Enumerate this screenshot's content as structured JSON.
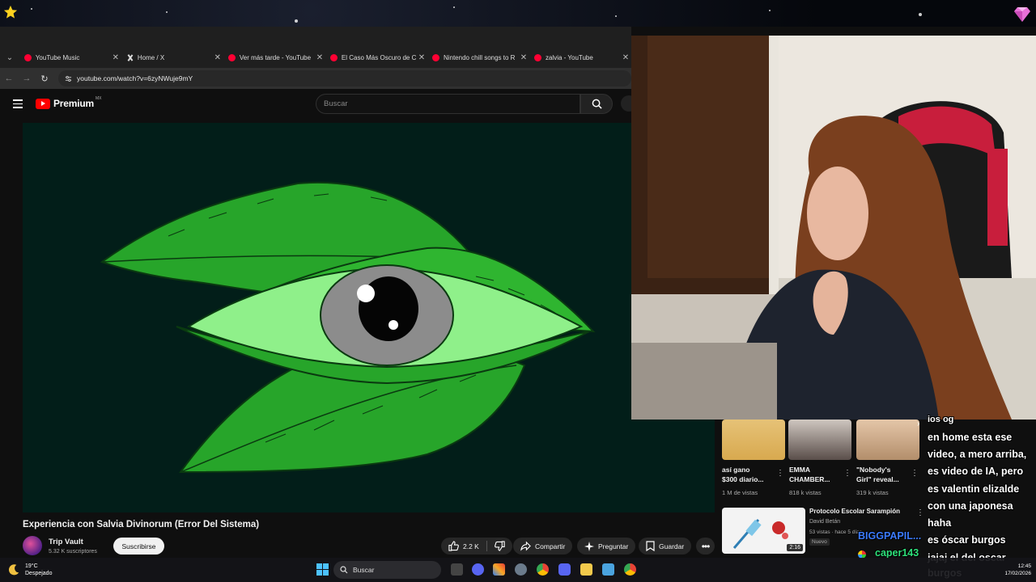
{
  "browser": {
    "tabs": [
      {
        "label": "YouTube Music",
        "icon": "youtube-music-icon"
      },
      {
        "label": "Home / X",
        "icon": "x-logo-icon"
      },
      {
        "label": "Ver más tarde - YouTube",
        "icon": "youtube-icon"
      },
      {
        "label": "El Caso Más Oscuro de C",
        "icon": "youtube-icon"
      },
      {
        "label": "Nintendo chill songs to R",
        "icon": "youtube-icon"
      },
      {
        "label": "zalvia - YouTube",
        "icon": "youtube-icon"
      }
    ],
    "url": "youtube.com/watch?v=6zyNWuje9mY"
  },
  "youtube": {
    "logo_text": "Premium",
    "country": "MX",
    "search_placeholder": "Buscar"
  },
  "video": {
    "title": "Experiencia con Salvia Divinorum (Error Del Sistema)",
    "channel": "Trip Vault",
    "subscribers": "5.32 K suscriptores",
    "subscribe_label": "Suscribirse",
    "likes": "2.2 K",
    "share_label": "Compartir",
    "ask_label": "Preguntar",
    "save_label": "Guardar"
  },
  "shorts": [
    {
      "title_l1": "así gano",
      "title_l2": "$300 diario...",
      "views": "1 M de vistas"
    },
    {
      "title_l1": "EMMA",
      "title_l2": "CHAMBER...",
      "views": "818 k vistas"
    },
    {
      "title_l1": "\"Nobody's",
      "title_l2": "Girl\" reveal...",
      "views": "319 k vistas"
    }
  ],
  "recommended": {
    "title": "Protocolo Escolar Sarampión",
    "channel": "David Betán",
    "meta": "53 vistas · hace 5 días",
    "badge": "Nuevo",
    "duration": "2:16"
  },
  "chat": {
    "lines": [
      "ios og",
      "en home esta ese",
      "video, a mero arriba,",
      "es video de IA, pero",
      "es valentin elizalde",
      "con una japonesa",
      "haha",
      "es óscar burgos"
    ],
    "user1": "BIGGPAPIL...",
    "user2": "caper143",
    "msg2_l1": "jajaj el del oscar",
    "msg2_l2": "burgos",
    "colors": {
      "user1": "#3b7bff",
      "user2": "#2de07a"
    }
  },
  "taskbar": {
    "temperature": "19°C",
    "condition": "Despejado",
    "search_label": "Buscar",
    "time": "12:45",
    "date": "17/02/2026"
  }
}
